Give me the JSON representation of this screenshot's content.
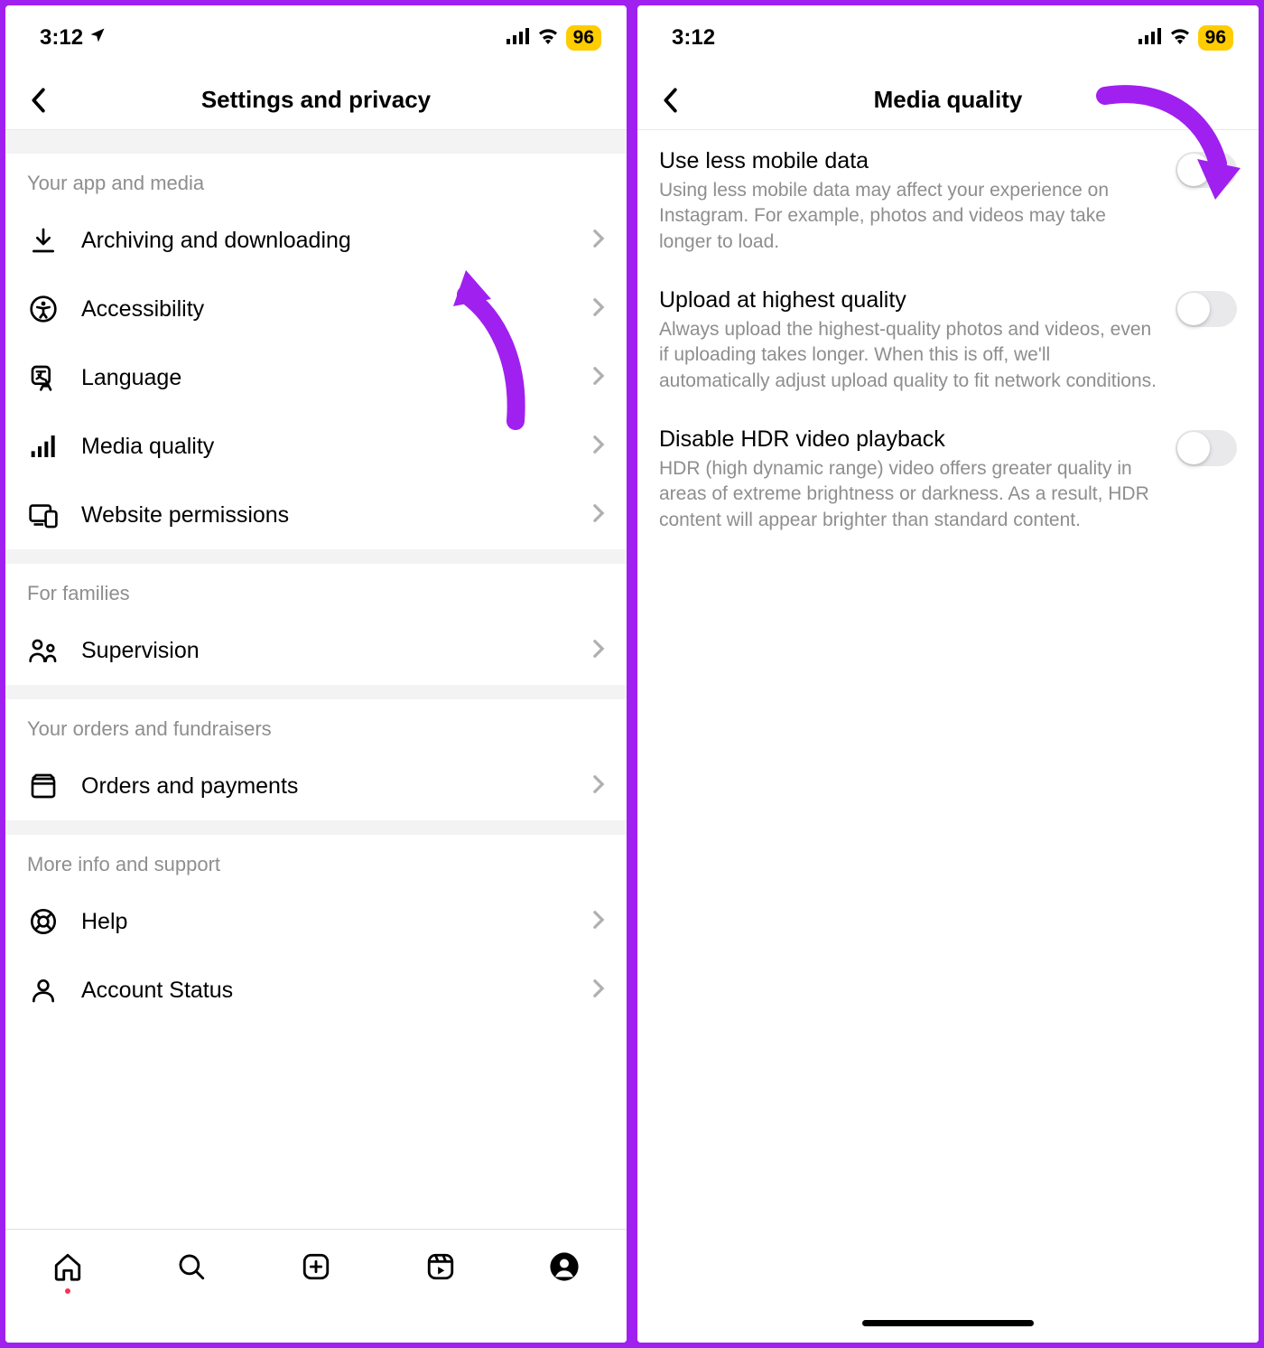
{
  "status": {
    "time": "3:12",
    "battery": "96"
  },
  "left": {
    "title": "Settings and privacy",
    "sections": [
      {
        "header": "Your app and media",
        "items": [
          {
            "name": "archiving",
            "label": "Archiving and downloading"
          },
          {
            "name": "accessibility",
            "label": "Accessibility"
          },
          {
            "name": "language",
            "label": "Language"
          },
          {
            "name": "media-quality",
            "label": "Media quality"
          },
          {
            "name": "website-permissions",
            "label": "Website permissions"
          }
        ]
      },
      {
        "header": "For families",
        "items": [
          {
            "name": "supervision",
            "label": "Supervision"
          }
        ]
      },
      {
        "header": "Your orders and fundraisers",
        "items": [
          {
            "name": "orders",
            "label": "Orders and payments"
          }
        ]
      },
      {
        "header": "More info and support",
        "items": [
          {
            "name": "help",
            "label": "Help"
          },
          {
            "name": "account-status",
            "label": "Account Status"
          }
        ]
      }
    ]
  },
  "right": {
    "title": "Media quality",
    "toggles": [
      {
        "name": "use-less-data",
        "title": "Use less mobile data",
        "desc": "Using less mobile data may affect your experience on Instagram. For example, photos and videos may take longer to load.",
        "on": false
      },
      {
        "name": "upload-highest",
        "title": "Upload at highest quality",
        "desc": "Always upload the highest-quality photos and videos, even if uploading takes longer. When this is off, we'll automatically adjust upload quality to fit network conditions.",
        "on": false
      },
      {
        "name": "disable-hdr",
        "title": "Disable HDR video playback",
        "desc": "HDR (high dynamic range) video offers greater quality in areas of extreme brightness or darkness. As a result, HDR content will appear brighter than standard content.",
        "on": false
      }
    ]
  }
}
